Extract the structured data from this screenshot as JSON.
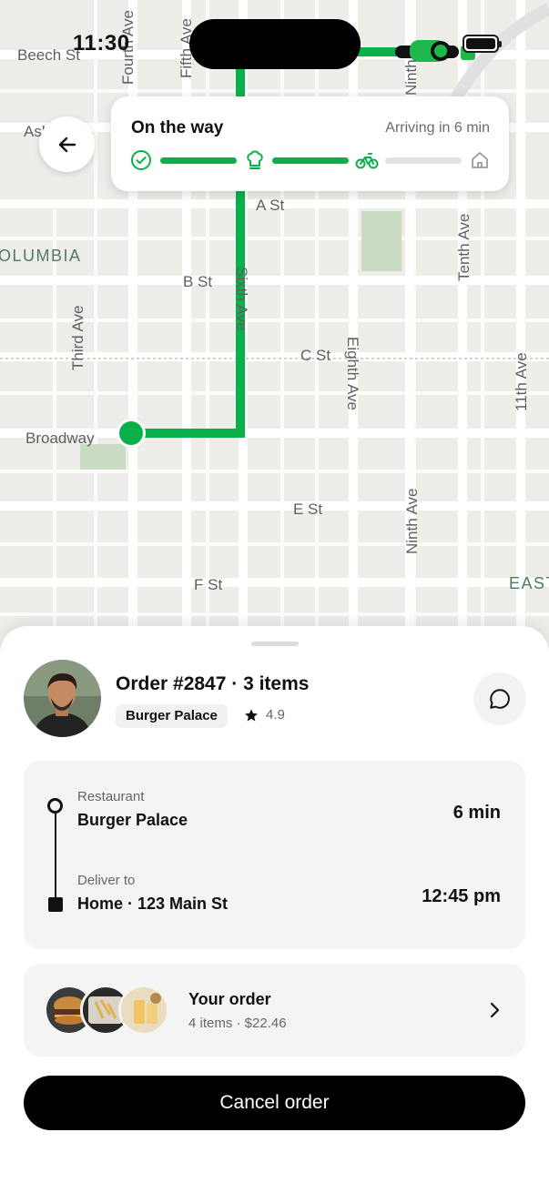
{
  "status_bar": {
    "time": "11:30"
  },
  "colors": {
    "route_green": "#0ab14b",
    "map_bg": "#eeedea",
    "park_green": "#c9dbc2"
  },
  "map": {
    "streets": {
      "beech": "Beech St",
      "fourth": "Fourth Ave",
      "fifth": "Fifth Ave",
      "ash": "Ash",
      "a_st": "A St",
      "columbia": "OLUMBIA",
      "b_st": "B St",
      "tenth": "Tenth Ave",
      "sixth": "Sixth Ave",
      "third": "Third Ave",
      "c_st": "C St",
      "eighth": "Eighth Ave",
      "eleventh": "11th Ave",
      "broadway": "Broadway",
      "e_st": "E St",
      "ninth": "Ninth Ave",
      "ninth_top": "Ninth",
      "f_st": "F St",
      "east": "EAST"
    }
  },
  "back_button": {
    "icon": "arrow-left-icon"
  },
  "progress": {
    "title": "On the way",
    "eta": "Arriving in 6 min",
    "steps": [
      "check-icon",
      "chef-hat-icon",
      "bike-icon",
      "home-icon"
    ]
  },
  "order": {
    "title": "Order #2847 · 3 items",
    "restaurant_badge": "Burger Palace",
    "rating": "4.9"
  },
  "route": {
    "pickup_label": "Restaurant",
    "pickup_name": "Burger Palace",
    "pickup_time": "6 min",
    "dropoff_label": "Deliver to",
    "dropoff_name": "Home · 123 Main St",
    "dropoff_time": "12:45 pm"
  },
  "order_summary": {
    "title": "Your order",
    "subtitle": "4 items · $22.46"
  },
  "cancel_button": {
    "label": "Cancel order"
  }
}
